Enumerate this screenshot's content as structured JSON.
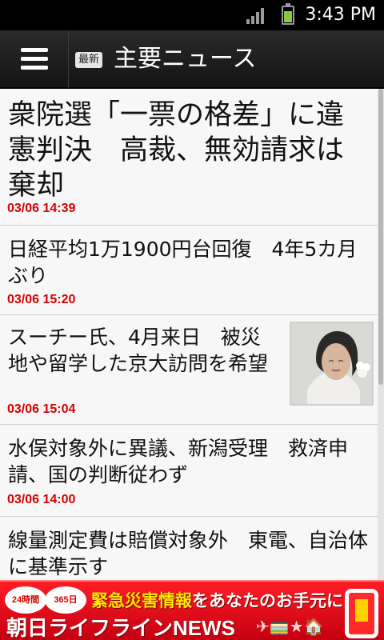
{
  "status_bar": {
    "time": "3:43 PM",
    "battery_level": 0.72,
    "signal_bars": 4
  },
  "header": {
    "badge": "最新",
    "title": "主要ニュース",
    "menu_icon": "hamburger-icon"
  },
  "news": [
    {
      "title": "衆院選「一票の格差」に違憲判決　高裁、無効請求は棄却",
      "time": "03/06 14:39"
    },
    {
      "title": "日経平均1万1900円台回復　4年5カ月ぶり",
      "time": "03/06 15:20"
    },
    {
      "title": "スーチー氏、4月来日　被災地や留学した京大訪問を希望",
      "time": "03/06 15:04",
      "thumbnail": "portrait-photo"
    },
    {
      "title": "水俣対象外に異議、新潟受理　救済申請、国の判断従わず",
      "time": "03/06 14:00"
    },
    {
      "title": "線量測定費は賠償対象外　東電、自治体に基準示す"
    }
  ],
  "ad": {
    "badge_left": "24時間",
    "badge_right": "365日",
    "headline_highlight": "緊急災害情報",
    "headline_rest": "をあなたのお手元に",
    "brand": "朝日ライフラインNEWS",
    "icons": "✈🚃★🏠"
  },
  "colors": {
    "accent_red": "#d60000",
    "banner_red": "#e00012",
    "header_bg": "#1e1e1e"
  }
}
